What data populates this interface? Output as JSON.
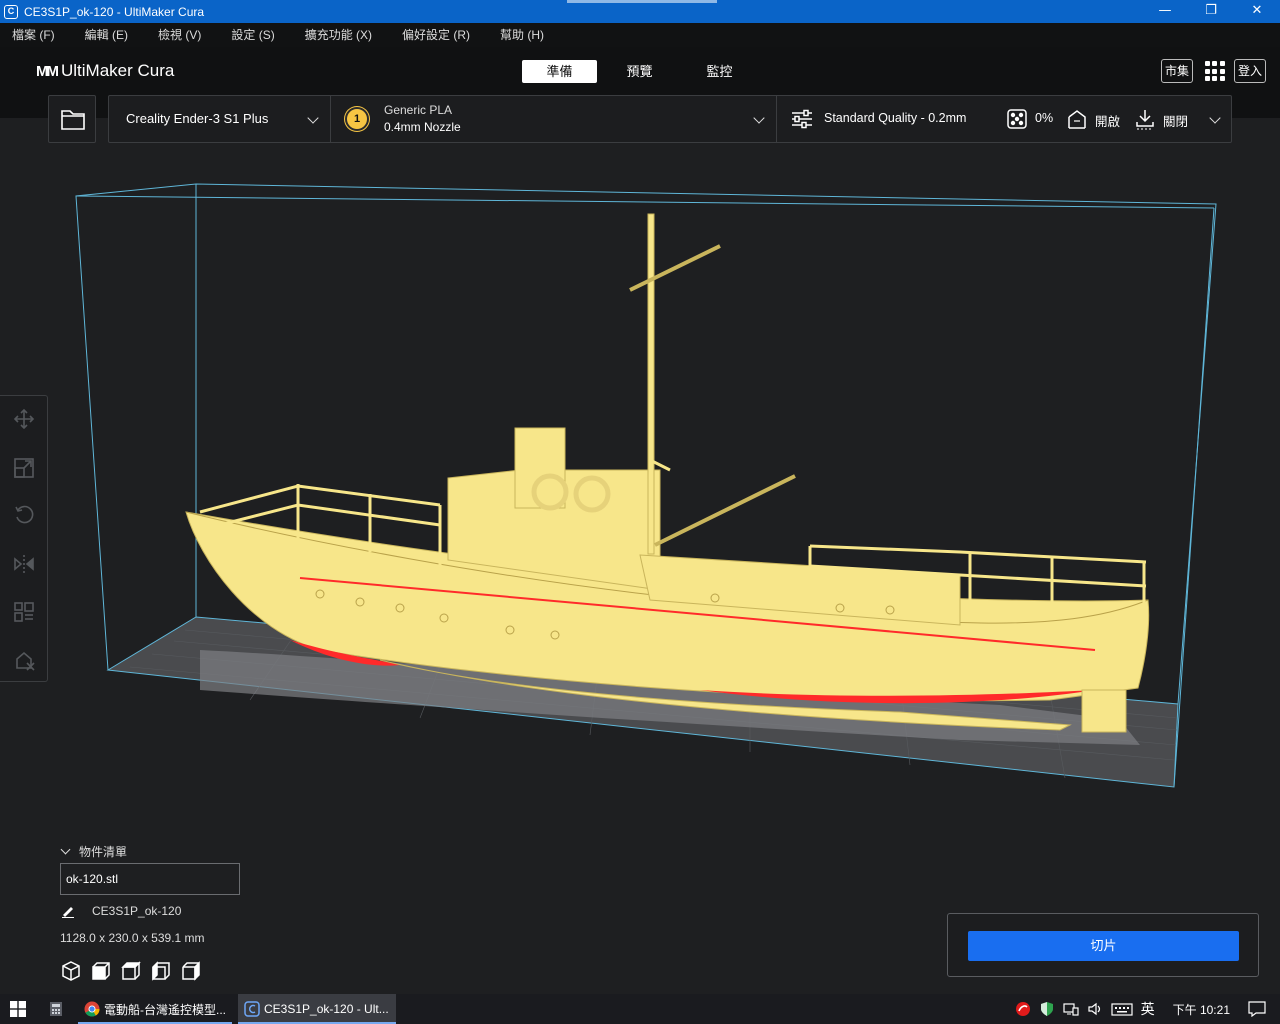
{
  "window": {
    "title": "CE3S1P_ok-120 - UltiMaker Cura",
    "app_icon": "C",
    "controls": {
      "minimize": "—",
      "maximize": "❐",
      "close": "✕"
    }
  },
  "menubar": {
    "items": [
      "檔案 (F)",
      "編輯 (E)",
      "檢視 (V)",
      "設定 (S)",
      "擴充功能 (X)",
      "偏好設定 (R)",
      "幫助 (H)"
    ]
  },
  "header": {
    "logo_mark": "MM",
    "logo_text": "UltiMaker Cura",
    "stages": [
      {
        "label": "準備",
        "active": true
      },
      {
        "label": "預覽",
        "active": false
      },
      {
        "label": "監控",
        "active": false
      }
    ],
    "marketplace_label": "市集",
    "apps_icon": "grid-icon",
    "signin_label": "登入"
  },
  "printer_bar": {
    "printer_name": "Creality Ender-3 S1 Plus",
    "material_badge": "1",
    "material_name": "Generic PLA",
    "nozzle": "0.4mm Nozzle",
    "profile": "Standard Quality - 0.2mm",
    "infill": "0%",
    "support": "開啟",
    "adhesion": "關閉"
  },
  "object_list": {
    "header": "物件清單",
    "items": [
      "ok-120.stl"
    ],
    "job_name": "CE3S1P_ok-120",
    "dimensions": "1128.0 x 230.0 x 539.1 mm"
  },
  "slice_panel": {
    "button_label": "切片"
  },
  "taskbar": {
    "tasks": [
      {
        "label": "電動船-台灣遙控模型...",
        "icon": "chrome-icon"
      },
      {
        "label": "CE3S1P_ok-120 - Ult...",
        "icon": "cura-icon"
      }
    ],
    "ime": "英",
    "clock": "下午 10:21"
  },
  "colors": {
    "accent_blue": "#196ef0",
    "model_yellow": "#f7e68a",
    "overhang_red": "#ff2a2a",
    "build_volume_line": "#5fb6d8",
    "titlebar_blue": "#0a64c8"
  }
}
